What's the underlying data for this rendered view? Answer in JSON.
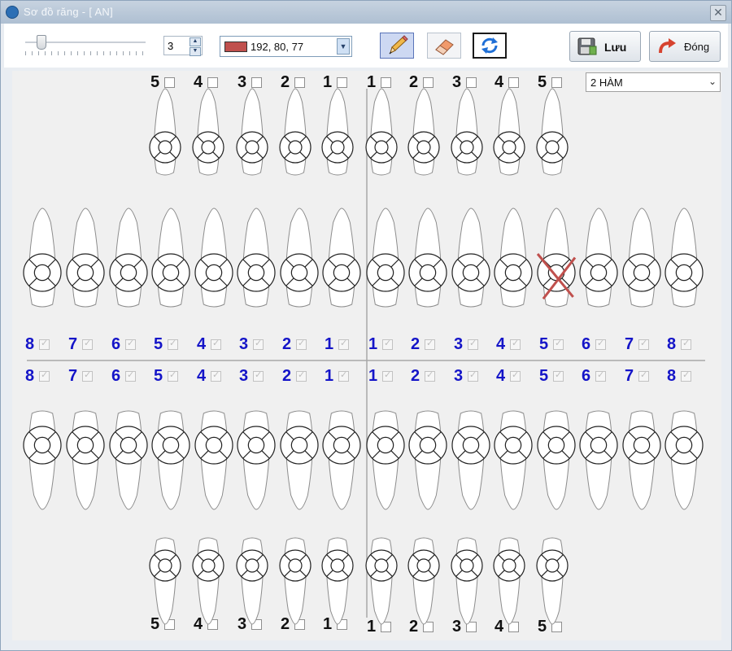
{
  "window": {
    "title": "Sơ đồ răng - [ AN]",
    "close_glyph": "✕"
  },
  "toolbar": {
    "slider_level": 0.1,
    "spin_value": "3",
    "spin_up": "▲",
    "spin_down": "▼",
    "color_text": "192, 80, 77",
    "color_hex": "#c0504d",
    "dropdown_arrow": "▼",
    "pencil_icon": "pencil-icon",
    "eraser_icon": "eraser-icon",
    "refresh_icon": "refresh-icon",
    "save_label": "Lưu",
    "close_label": "Đóng"
  },
  "jaw_select": {
    "value": "2 HÀM",
    "arrow": "⌄"
  },
  "rows": {
    "upper_small_labels_left": [
      "5",
      "4",
      "3",
      "2",
      "1"
    ],
    "upper_small_labels_right": [
      "1",
      "2",
      "3",
      "4",
      "5"
    ],
    "upper_labels_left": [
      "8",
      "7",
      "6",
      "5",
      "4",
      "3",
      "2",
      "1"
    ],
    "upper_labels_right": [
      "1",
      "2",
      "3",
      "4",
      "5",
      "6",
      "7",
      "8"
    ],
    "lower_labels_left": [
      "8",
      "7",
      "6",
      "5",
      "4",
      "3",
      "2",
      "1"
    ],
    "lower_labels_right": [
      "1",
      "2",
      "3",
      "4",
      "5",
      "6",
      "7",
      "8"
    ],
    "lower_small_labels_left": [
      "5",
      "4",
      "3",
      "2",
      "1"
    ],
    "lower_small_labels_right": [
      "1",
      "2",
      "3",
      "4",
      "5"
    ]
  },
  "marked_tooth": {
    "quadrant": "upper-right",
    "number": "5",
    "mark": "X",
    "color": "#c0504d"
  }
}
